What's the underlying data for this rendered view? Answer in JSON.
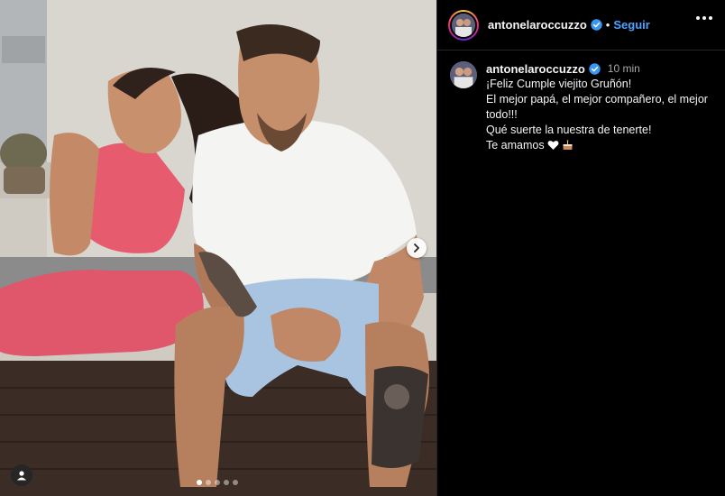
{
  "post": {
    "author": {
      "username": "antonelaroccuzzo",
      "verified": true,
      "follow_label": "Seguir",
      "separator": "•"
    },
    "media": {
      "description_icon": "photo",
      "carousel": {
        "count": 5,
        "active_index": 0
      },
      "controls": {
        "next_icon": "chevron-right-icon",
        "tag_icon": "user-tag-icon"
      }
    },
    "caption": {
      "username": "antonelaroccuzzo",
      "time": "10 min",
      "lines": [
        "¡Feliz Cumple viejito Gruñón!",
        "El mejor papá, el mejor compañero, el mejor todo!!!",
        "Qué suerte la nuestra de tenerte!",
        "Te amamos"
      ],
      "emojis": [
        "white-heart",
        "birthday-cake"
      ]
    },
    "colors": {
      "background": "#000000",
      "follow": "#4aa3ff",
      "verified": "#3897f0",
      "muted": "#a8a8a8"
    }
  }
}
